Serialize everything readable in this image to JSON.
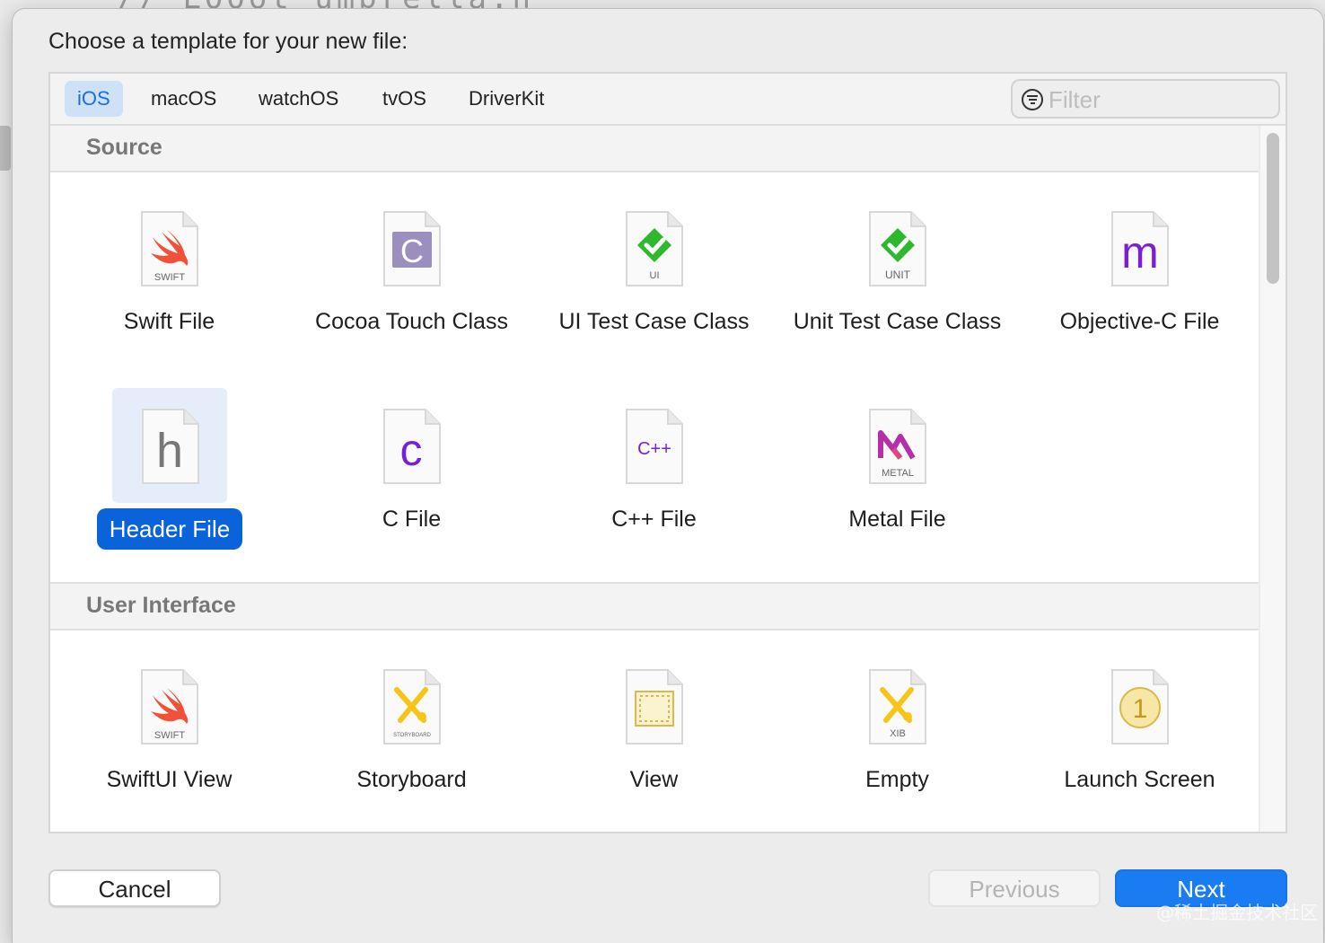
{
  "background": {
    "code_text": "// LOOot umbrella.h"
  },
  "dialog": {
    "prompt": "Choose a template for your new file:"
  },
  "tabs": [
    "iOS",
    "macOS",
    "watchOS",
    "tvOS",
    "DriverKit"
  ],
  "active_tab": "iOS",
  "filter": {
    "placeholder": "Filter",
    "value": ""
  },
  "sections": [
    {
      "title": "Source",
      "items": [
        {
          "label": "Swift File",
          "icon": "swift-file-icon",
          "badge": "SWIFT"
        },
        {
          "label": "Cocoa Touch Class",
          "icon": "cocoa-touch-class-icon",
          "badge": "C"
        },
        {
          "label": "UI Test Case Class",
          "icon": "ui-test-case-icon",
          "badge": "UI"
        },
        {
          "label": "Unit Test Case Class",
          "icon": "unit-test-case-icon",
          "badge": "UNIT"
        },
        {
          "label": "Objective-C File",
          "icon": "objective-c-file-icon",
          "badge": "m"
        },
        {
          "label": "Header File",
          "icon": "header-file-icon",
          "badge": "h",
          "selected": true
        },
        {
          "label": "C File",
          "icon": "c-file-icon",
          "badge": "c"
        },
        {
          "label": "C++ File",
          "icon": "cpp-file-icon",
          "badge": "C++"
        },
        {
          "label": "Metal File",
          "icon": "metal-file-icon",
          "badge": "METAL"
        }
      ]
    },
    {
      "title": "User Interface",
      "items": [
        {
          "label": "SwiftUI View",
          "icon": "swiftui-view-icon",
          "badge": "SWIFT"
        },
        {
          "label": "Storyboard",
          "icon": "storyboard-icon",
          "badge": "STORYBOARD"
        },
        {
          "label": "View",
          "icon": "view-icon",
          "badge": ""
        },
        {
          "label": "Empty",
          "icon": "empty-xib-icon",
          "badge": "XIB"
        },
        {
          "label": "Launch Screen",
          "icon": "launch-screen-icon",
          "badge": "1"
        }
      ]
    }
  ],
  "buttons": {
    "cancel": "Cancel",
    "previous": "Previous",
    "next": "Next"
  },
  "watermark": "@稀土掘金技术社区",
  "colors": {
    "accent": "#0a63d9",
    "next_button": "#1a7cf3",
    "selected_tab_bg": "#cfe1f7",
    "swift": "#f05138",
    "check_green": "#2eb82e",
    "purple": "#7b1fd6"
  }
}
